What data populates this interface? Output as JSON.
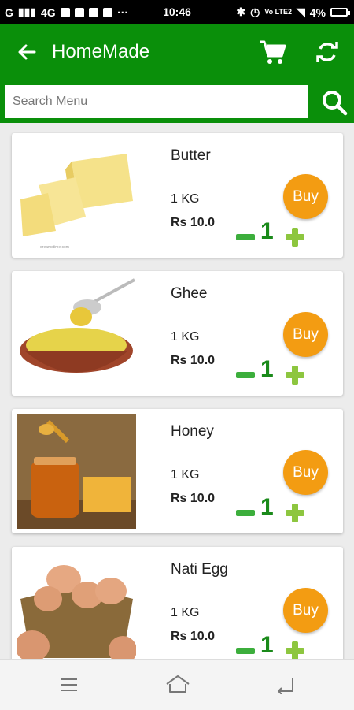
{
  "status_bar": {
    "carrier": "G",
    "network": "4G",
    "time": "10:46",
    "volte": "Vo LTE2",
    "battery": "4%"
  },
  "app_bar": {
    "title": "HomeMade",
    "back_icon": "arrow-left-icon",
    "cart_icon": "cart-icon",
    "refresh_icon": "refresh-icon"
  },
  "search": {
    "placeholder": "Search Menu",
    "value": ""
  },
  "colors": {
    "primary": "#0a8f0a",
    "buy": "#f39c12",
    "counter": "#1a8a1a"
  },
  "products": [
    {
      "name": "Butter",
      "qty": "1 KG",
      "price": "Rs 10.0",
      "buy_label": "Buy",
      "count": "1",
      "image": "butter-image"
    },
    {
      "name": "Ghee",
      "qty": "1 KG",
      "price": "Rs 10.0",
      "buy_label": "Buy",
      "count": "1",
      "image": "ghee-image"
    },
    {
      "name": "Honey",
      "qty": "1 KG",
      "price": "Rs 10.0",
      "buy_label": "Buy",
      "count": "1",
      "image": "honey-image"
    },
    {
      "name": "Nati Egg",
      "qty": "1 KG",
      "price": "Rs 10.0",
      "buy_label": "Buy",
      "count": "1",
      "image": "egg-image"
    }
  ],
  "nav_bar": {
    "menu_icon": "menu-icon",
    "home_icon": "home-icon",
    "back_icon": "back-icon"
  }
}
